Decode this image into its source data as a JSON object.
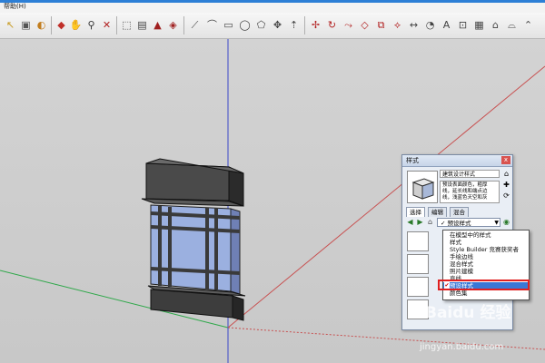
{
  "menubar": {
    "label": "帮助(H)"
  },
  "toolbar": {
    "icons": [
      "select-icon",
      "make-component-icon",
      "paint-bucket-icon",
      "eraser-icon",
      "orbit-icon",
      "pan-icon",
      "zoom-icon",
      "zoom-extents-icon",
      "view-iso-icon",
      "view-top-icon",
      "view-front-icon",
      "view-right-icon",
      "view-back-icon",
      "view-left-icon",
      "3d-warehouse-icon",
      "get-models-icon",
      "share-model-icon",
      "share-component-icon",
      "line-icon",
      "arc-icon",
      "freehand-icon",
      "rectangle-icon",
      "circle-icon",
      "polygon-icon",
      "move-icon",
      "push-pull-icon",
      "rotate-icon",
      "follow-me-icon",
      "scale-icon",
      "offset-icon",
      "tape-measure-icon",
      "dimension-icon",
      "protractor-icon",
      "text-icon",
      "axes-icon",
      "3d-text-icon",
      "section-plane-icon",
      "walk-icon",
      "look-around-icon",
      "position-camera-icon",
      "sandbox-icon"
    ]
  },
  "panel": {
    "title": "样式",
    "close": "x",
    "style_name": "建筑设计样式",
    "description": "预设表面颜色，粗厚线，延长线和端点边线，浅蓝色天空和灰",
    "tabs": [
      "选择",
      "编辑",
      "混合"
    ],
    "combo_value": "✓ 预设样式",
    "combo_arrow": "▼"
  },
  "dropdown": {
    "items": [
      {
        "label": "在模型中的样式",
        "selected": false
      },
      {
        "label": "样式",
        "selected": false
      },
      {
        "label": "Style Builder 竞赛获奖者",
        "selected": false
      },
      {
        "label": "手绘边线",
        "selected": false
      },
      {
        "label": "混合样式",
        "selected": false
      },
      {
        "label": "照片建模",
        "selected": false
      },
      {
        "label": "直线",
        "selected": false
      },
      {
        "label": "预设样式",
        "selected": true
      },
      {
        "label": "颜色集",
        "selected": false
      }
    ],
    "check_mark": "✔"
  },
  "watermark": {
    "text": "Baidu 经验",
    "url": "jingyan.baidu.com"
  },
  "colors": {
    "accent": "#3a77d6",
    "highlight_border": "#e02020",
    "glass": "#9bb0e0"
  }
}
